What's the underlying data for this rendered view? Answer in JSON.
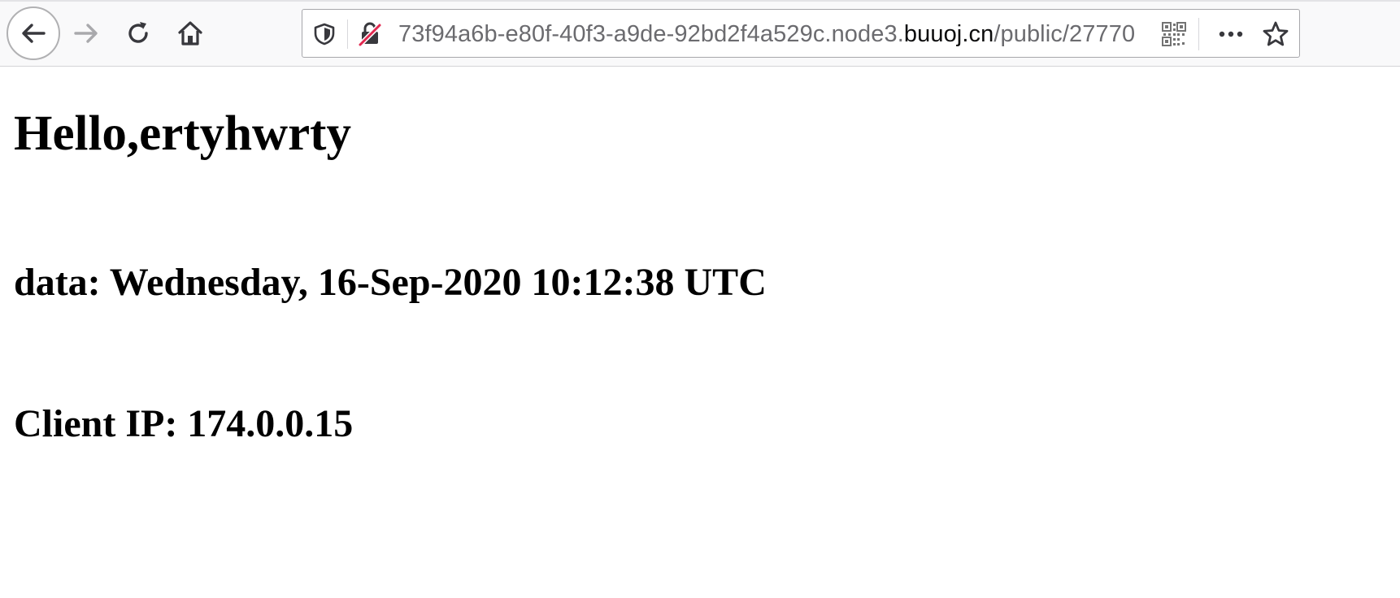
{
  "browser": {
    "url_prefix": "73f94a6b-e80f-40f3-a9de-92bd2f4a529c.node3.",
    "url_domain": "buuoj.cn",
    "url_path": "/public/27770",
    "icons": {
      "back": "back-arrow-icon",
      "forward": "forward-arrow-icon",
      "reload": "reload-icon",
      "home": "home-icon",
      "tracking": "shield-icon",
      "insecure": "insecure-lock-icon",
      "qr": "qr-code-icon",
      "more": "more-dots-icon",
      "bookmark": "star-icon"
    },
    "colors": {
      "toolbar_bg": "#f9f9fa",
      "url_text": "#6b6b6f",
      "url_domain": "#0c0c0d",
      "insecure_slash": "#e22850"
    }
  },
  "page": {
    "greeting": "Hello,ertyhwrty",
    "date_line": "data: Wednesday, 16-Sep-2020 10:12:38 UTC",
    "ip_line": "Client IP: 174.0.0.15"
  }
}
